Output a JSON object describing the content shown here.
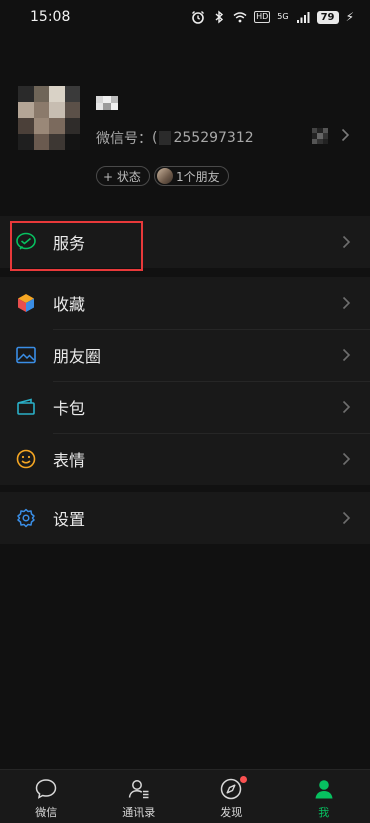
{
  "status_bar": {
    "time": "15:08",
    "network_badge": "HD",
    "signal_badge": "5G",
    "battery": "79"
  },
  "profile": {
    "name_partial": "棠",
    "wechat_id_label": "微信号：",
    "wechat_id_prefix": "(",
    "wechat_id_value": "255297312",
    "status_button": "+ 状态",
    "friends_button": "1个朋友"
  },
  "menu": {
    "services": "服务",
    "favorites": "收藏",
    "moments": "朋友圈",
    "cards": "卡包",
    "stickers": "表情",
    "settings": "设置"
  },
  "tabs": [
    {
      "label": "微信"
    },
    {
      "label": "通讯录"
    },
    {
      "label": "发现"
    },
    {
      "label": "我"
    }
  ],
  "colors": {
    "background": "#111111",
    "surface": "#191919",
    "accent": "#07c160",
    "highlight_box": "#e8393a",
    "notification_dot": "#fa5151"
  },
  "icons": {
    "services": "wechat-pay-icon",
    "favorites": "cube-icon",
    "moments": "picture-icon",
    "cards": "wallet-icon",
    "stickers": "smiley-icon",
    "settings": "gear-icon"
  }
}
